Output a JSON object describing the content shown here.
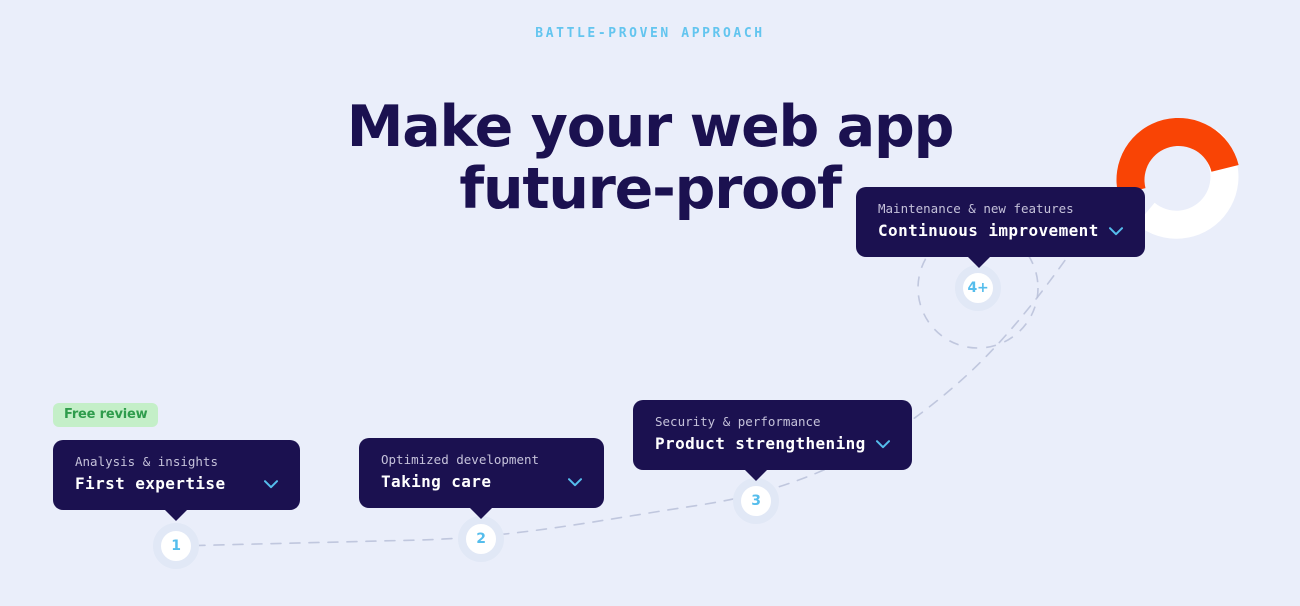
{
  "theme": {
    "background": "#eaeefa",
    "card_bg": "#1b1150",
    "heading_color": "#1b1150",
    "accent_blue": "#55bdec",
    "eyebrow_color": "#63c5ef",
    "badge_bg": "#c4efc8",
    "badge_text": "#2f9c4c",
    "arc_orange": "#f94405",
    "arc_white": "#ffffff",
    "dash_color": "#b9c0d8",
    "node_ring": "#e1e8f6"
  },
  "header": {
    "eyebrow": "BATTLE-PROVEN APPROACH",
    "headline_line1": "Make your web app",
    "headline_line2": "future-proof"
  },
  "badge": {
    "label": "Free review"
  },
  "chevron_icon": "chevron-down-icon",
  "steps": [
    {
      "number": "1",
      "caption": "Analysis & insights",
      "title": "First expertise",
      "chevron": "⌄"
    },
    {
      "number": "2",
      "caption": "Optimized development",
      "title": "Taking care",
      "chevron": "⌄"
    },
    {
      "number": "3",
      "caption": "Security & performance",
      "title": "Product strengthening",
      "chevron": "⌄"
    },
    {
      "number": "4+",
      "caption": "Maintenance & new features",
      "title": "Continuous improvement",
      "chevron": "⌄"
    }
  ]
}
